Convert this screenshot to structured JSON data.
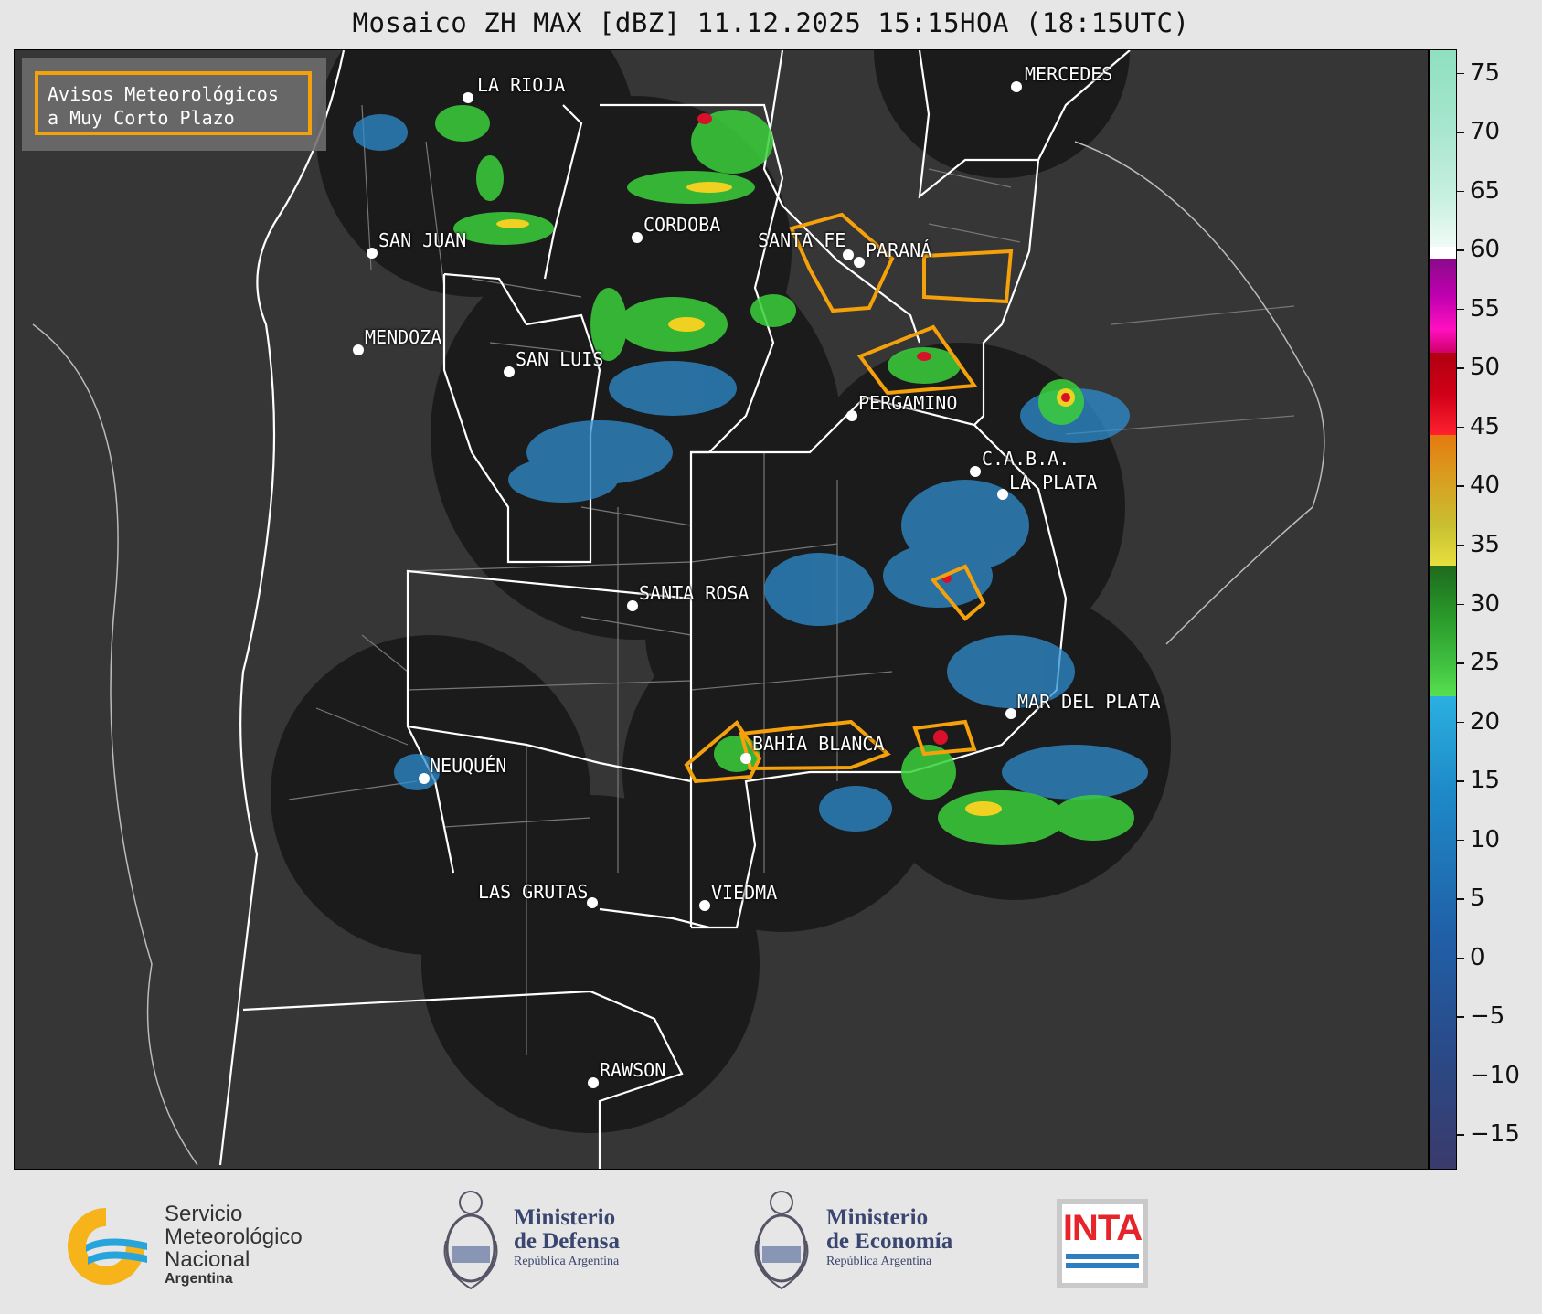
{
  "title": "Mosaico ZH MAX [dBZ] 11.12.2025 15:15HOA (18:15UTC)",
  "legend": {
    "line1": "Avisos Meteorológicos",
    "line2": "a Muy Corto Plazo",
    "border_color": "#f5a10b"
  },
  "cities": [
    {
      "name": "LA RIOJA"
    },
    {
      "name": "MERCEDES"
    },
    {
      "name": "SAN JUAN"
    },
    {
      "name": "CORDOBA"
    },
    {
      "name": "SANTA FE"
    },
    {
      "name": "PARANÁ"
    },
    {
      "name": "MENDOZA"
    },
    {
      "name": "SAN LUIS"
    },
    {
      "name": "PERGAMINO"
    },
    {
      "name": "C.A.B.A."
    },
    {
      "name": "LA PLATA"
    },
    {
      "name": "SANTA ROSA"
    },
    {
      "name": "MAR DEL PLATA"
    },
    {
      "name": "BAHÍA BLANCA"
    },
    {
      "name": "NEUQUÉN"
    },
    {
      "name": "LAS GRUTAS"
    },
    {
      "name": "VIEDMA"
    },
    {
      "name": "RAWSON"
    }
  ],
  "colorbar": {
    "min": -18,
    "max": 77,
    "ticks": [
      "75",
      "70",
      "65",
      "60",
      "55",
      "50",
      "45",
      "40",
      "35",
      "30",
      "25",
      "20",
      "15",
      "10",
      "5",
      "0",
      "−5",
      "−10",
      "−15"
    ],
    "tick_values": [
      75,
      70,
      65,
      60,
      55,
      50,
      45,
      40,
      35,
      30,
      25,
      20,
      15,
      10,
      5,
      0,
      -5,
      -10,
      -15
    ]
  },
  "logos": {
    "smn_line1": "Servicio",
    "smn_line2": "Meteorológico",
    "smn_line3": "Nacional",
    "smn_line4": "Argentina",
    "defensa_line1": "Ministerio",
    "defensa_line2": "de Defensa",
    "defensa_line3": "República Argentina",
    "economia_line1": "Ministerio",
    "economia_line2": "de Economía",
    "economia_line3": "República Argentina",
    "inta": "INTA"
  },
  "colors": {
    "warning": "#f5a10b",
    "radar_bg": "#1b1b1b",
    "map_bg": "#363636",
    "boundary": "#ffffff"
  }
}
